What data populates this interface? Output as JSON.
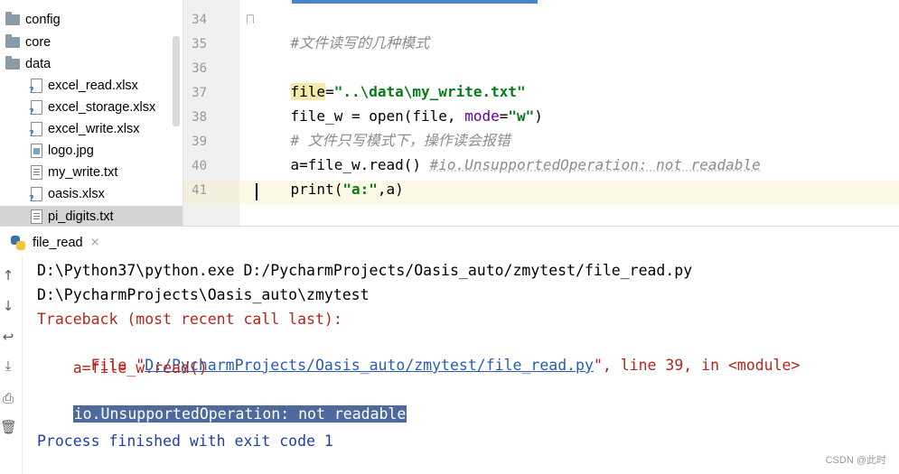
{
  "project_tree": {
    "items": [
      {
        "label": "config",
        "kind": "folder",
        "icon": "folder-icon"
      },
      {
        "label": "core",
        "kind": "folder",
        "icon": "folder-icon"
      },
      {
        "label": "data",
        "kind": "folder",
        "icon": "folder-icon"
      },
      {
        "label": "excel_read.xlsx",
        "kind": "xlsx",
        "icon": "excel-file-icon"
      },
      {
        "label": "excel_storage.xlsx",
        "kind": "xlsx",
        "icon": "excel-file-icon"
      },
      {
        "label": "excel_write.xlsx",
        "kind": "xlsx",
        "icon": "excel-file-icon"
      },
      {
        "label": "logo.jpg",
        "kind": "img",
        "icon": "image-file-icon"
      },
      {
        "label": "my_write.txt",
        "kind": "txt",
        "icon": "text-file-icon"
      },
      {
        "label": "oasis.xlsx",
        "kind": "xlsx",
        "icon": "excel-file-icon"
      },
      {
        "label": "pi_digits.txt",
        "kind": "txt",
        "icon": "text-file-icon",
        "selected": true
      }
    ]
  },
  "editor": {
    "line_numbers": [
      "34",
      "35",
      "36",
      "37",
      "38",
      "39",
      "40",
      "41"
    ],
    "lines": {
      "l34": "#文件读写的几种模式",
      "l36_var": "file",
      "l36_eq": "=",
      "l36_str": "\"..\\data\\my_write.txt\"",
      "l37_a": "file_w = open(file, ",
      "l37_param": "mode",
      "l37_eq": "=",
      "l37_str": "\"w\"",
      "l37_end": ")",
      "l38": "# 文件只写模式下，操作读会报错",
      "l39_code": "a=file_w.read() ",
      "l39_comment": "#io.UnsupportedOperation: not readable",
      "l40_a": "print(",
      "l40_str": "\"a:\"",
      "l40_end": ",a)"
    }
  },
  "run_panel": {
    "tab_label": "file_read",
    "close_glyph": "×",
    "toolbar_icons": [
      "arrow-up-icon",
      "arrow-down-icon",
      "soft-wrap-icon",
      "scroll-to-end-icon",
      "print-icon",
      "trash-icon"
    ],
    "console": {
      "cmd": "D:\\Python37\\python.exe D:/PycharmProjects/Oasis_auto/zmytest/file_read.py",
      "cwd": "D:\\PycharmProjects\\Oasis_auto\\zmytest",
      "traceback_header": "Traceback (most recent call last):",
      "file_prefix": "  File \"",
      "file_link": "D:/PycharmProjects/Oasis_auto/zmytest/file_read.py",
      "file_suffix": "\", line 39, in <module>",
      "code_line": "    a=file_w.read()",
      "exception": "io.UnsupportedOperation: not readable",
      "exit": "Process finished with exit code 1"
    }
  },
  "watermark": "CSDN @此时"
}
